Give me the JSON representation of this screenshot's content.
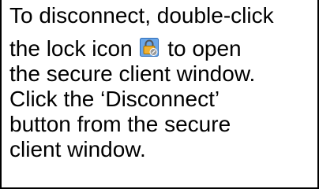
{
  "instructions": {
    "line_1": "To disconnect, double-click",
    "line_2_before": "the lock icon",
    "line_2_after": "to open",
    "line_3": "the secure client window.",
    "line_4": "Click the ‘Disconnect’",
    "line_5": "button from the secure",
    "line_6": "client window."
  },
  "icon": {
    "name": "lock-icon",
    "background_color": "#6aa6e8",
    "lock_color": "#f0b030",
    "badge_color": "#9a9a9a"
  }
}
